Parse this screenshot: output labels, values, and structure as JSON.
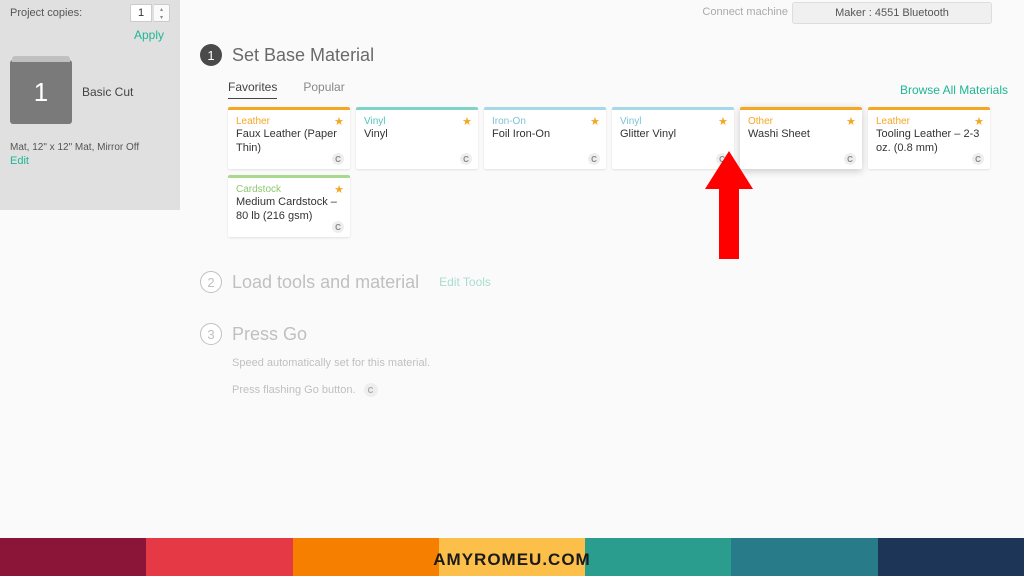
{
  "sidebar": {
    "project_copies_label": "Project copies:",
    "project_copies_value": "1",
    "apply_label": "Apply",
    "mat_number": "1",
    "cut_type": "Basic Cut",
    "mat_info": "Mat, 12\" x 12\" Mat, Mirror Off",
    "edit_label": "Edit"
  },
  "header": {
    "connect_label": "Connect machine",
    "machine_name": "Maker : 4551 Bluetooth"
  },
  "steps": {
    "s1": {
      "num": "1",
      "title": "Set Base Material"
    },
    "s2": {
      "num": "2",
      "title": "Load tools and material",
      "edit_tools": "Edit Tools"
    },
    "s3": {
      "num": "3",
      "title": "Press Go",
      "line1": "Speed automatically set for this material.",
      "line2": "Press flashing Go button.",
      "badge": "C"
    }
  },
  "tabs": {
    "favorites": "Favorites",
    "popular": "Popular",
    "browse": "Browse All Materials"
  },
  "materials": [
    {
      "category": "Leather",
      "name": "Faux Leather (Paper Thin)",
      "color": "orange"
    },
    {
      "category": "Vinyl",
      "name": "Vinyl",
      "color": "teal"
    },
    {
      "category": "Iron-On",
      "name": "Foil Iron-On",
      "color": "blue"
    },
    {
      "category": "Vinyl",
      "name": "Glitter Vinyl",
      "color": "blue2"
    },
    {
      "category": "Other",
      "name": "Washi Sheet",
      "color": "orange",
      "highlight": true
    },
    {
      "category": "Leather",
      "name": "Tooling Leather – 2-3 oz. (0.8 mm)",
      "color": "orange"
    },
    {
      "category": "Cardstock",
      "name": "Medium Cardstock – 80 lb (216 gsm)",
      "color": "green"
    }
  ],
  "badges": {
    "c": "C"
  },
  "footer": {
    "text": "AMYROMEU.COM",
    "colors": [
      "#8a1538",
      "#e63946",
      "#f77f00",
      "#fcbf49",
      "#2a9d8f",
      "#264653",
      "#1d3557"
    ]
  }
}
